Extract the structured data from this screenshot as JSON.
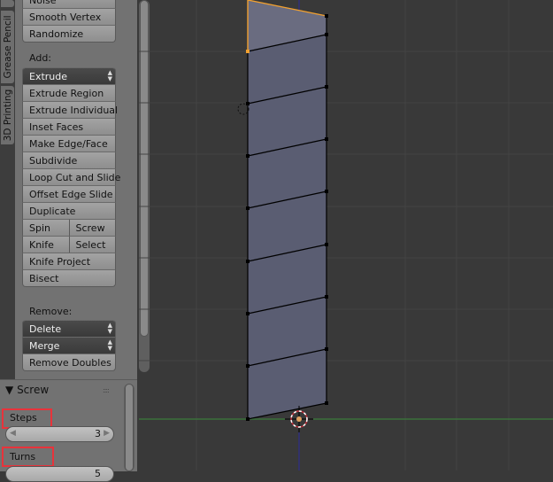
{
  "tabs": [
    {
      "label": "Grease Pencil"
    },
    {
      "label": "3D Printing"
    }
  ],
  "toolshelf": {
    "deform_buttons": [
      "Noise",
      "Smooth Vertex",
      "Randomize"
    ],
    "add_label": "Add:",
    "extrude_dropdown": "Extrude",
    "add_buttons": [
      "Extrude Region",
      "Extrude Individual",
      "Inset Faces",
      "Make Edge/Face",
      "Subdivide",
      "Loop Cut and Slide",
      "Offset Edge Slide",
      "Duplicate"
    ],
    "pair_rows": [
      [
        "Spin",
        "Screw"
      ],
      [
        "Knife",
        "Select"
      ]
    ],
    "add_buttons_after": [
      "Knife Project",
      "Bisect"
    ],
    "remove_label": "Remove:",
    "delete_dropdown": "Delete",
    "merge_dropdown": "Merge",
    "remove_doubles": "Remove Doubles"
  },
  "operator_panel": {
    "title": "Screw",
    "steps_label": "Steps",
    "steps_value": "3",
    "turns_label": "Turns",
    "turns_value": "5"
  },
  "colors": {
    "highlight": "#e8333b",
    "selected_edge": "#f0a030",
    "x_axis": "#3a8a3a",
    "z_axis": "#2a2a9a",
    "mesh_face": "#5a5d72"
  }
}
